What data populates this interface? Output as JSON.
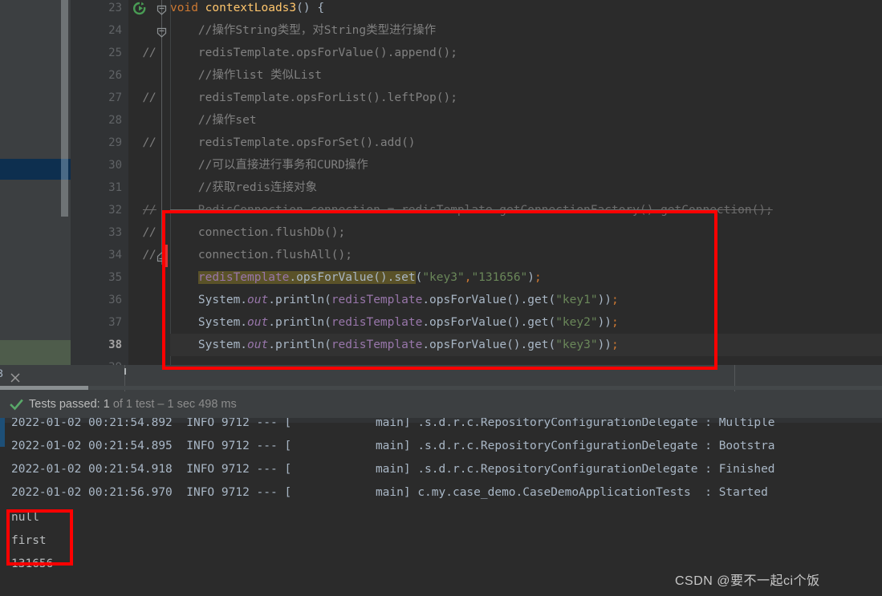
{
  "editor": {
    "lines": [
      {
        "num": "23",
        "gutter_icon": "run-method-icon",
        "fold": "fold-start",
        "comment_marker": "",
        "current": false,
        "tokens": [
          {
            "t": "void ",
            "c": "kw"
          },
          {
            "t": "contextLoads3",
            "c": "mth"
          },
          {
            "t": "() {",
            "c": "plain"
          }
        ]
      },
      {
        "num": "24",
        "gutter_icon": "",
        "fold": "fold-start",
        "comment_marker": "",
        "current": false,
        "tokens": [
          {
            "t": "    //操作String类型，对String类型进行操作",
            "c": "cmt"
          }
        ]
      },
      {
        "num": "25",
        "gutter_icon": "",
        "fold": "",
        "comment_marker": "//",
        "current": false,
        "tokens": [
          {
            "t": "    redisTemplate.opsForValue().append();",
            "c": "cmt"
          }
        ]
      },
      {
        "num": "26",
        "gutter_icon": "",
        "fold": "",
        "comment_marker": "",
        "current": false,
        "tokens": [
          {
            "t": "    //操作list 类似List",
            "c": "cmt"
          }
        ]
      },
      {
        "num": "27",
        "gutter_icon": "",
        "fold": "",
        "comment_marker": "//",
        "current": false,
        "tokens": [
          {
            "t": "    redisTemplate.opsForList().leftPop();",
            "c": "cmt"
          }
        ]
      },
      {
        "num": "28",
        "gutter_icon": "",
        "fold": "",
        "comment_marker": "",
        "current": false,
        "tokens": [
          {
            "t": "    //操作set",
            "c": "cmt"
          }
        ]
      },
      {
        "num": "29",
        "gutter_icon": "",
        "fold": "",
        "comment_marker": "//",
        "current": false,
        "tokens": [
          {
            "t": "    redisTemplate.opsForSet().add()",
            "c": "cmt"
          }
        ]
      },
      {
        "num": "30",
        "gutter_icon": "",
        "fold": "",
        "comment_marker": "",
        "current": false,
        "tokens": [
          {
            "t": "    //可以直接进行事务和CURD操作",
            "c": "cmt"
          }
        ]
      },
      {
        "num": "31",
        "gutter_icon": "",
        "fold": "",
        "comment_marker": "",
        "current": false,
        "tokens": [
          {
            "t": "    //获取redis连接对象",
            "c": "cmt"
          }
        ]
      },
      {
        "num": "32",
        "gutter_icon": "",
        "fold": "",
        "comment_marker": "//",
        "comment_marker_style": "strike",
        "current": false,
        "tokens": [
          {
            "t": "    RedisConnection connection = redisTemplate.getConnectionFactory().getConnection();",
            "c": "strike"
          }
        ]
      },
      {
        "num": "33",
        "gutter_icon": "",
        "fold": "",
        "comment_marker": "//",
        "current": false,
        "tokens": [
          {
            "t": "    connection.flushDb();",
            "c": "cmt"
          }
        ]
      },
      {
        "num": "34",
        "gutter_icon": "",
        "fold": "fold-end",
        "comment_marker": "//",
        "current": false,
        "tokens": [
          {
            "t": "    connection.flushAll();",
            "c": "cmt"
          }
        ]
      },
      {
        "num": "35",
        "gutter_icon": "",
        "fold": "",
        "comment_marker": "",
        "current": false,
        "tokens": [
          {
            "t": "    ",
            "c": "plain"
          },
          {
            "t": "redisTemplate",
            "c": "fld setbg"
          },
          {
            "t": ".",
            "c": "plain setbg"
          },
          {
            "t": "opsForValue",
            "c": "plain setbg"
          },
          {
            "t": "()",
            "c": "plain setbg"
          },
          {
            "t": ".",
            "c": "plain setbg"
          },
          {
            "t": "set",
            "c": "plain setbg"
          },
          {
            "t": "(",
            "c": "plain"
          },
          {
            "t": "\"key3\"",
            "c": "str"
          },
          {
            "t": ",",
            "c": "kw"
          },
          {
            "t": "\"131656\"",
            "c": "str"
          },
          {
            "t": ")",
            "c": "plain"
          },
          {
            "t": ";",
            "c": "kw"
          }
        ]
      },
      {
        "num": "36",
        "gutter_icon": "",
        "fold": "",
        "comment_marker": "",
        "current": false,
        "tokens": [
          {
            "t": "    System.",
            "c": "plain"
          },
          {
            "t": "out",
            "c": "ital"
          },
          {
            "t": ".println(",
            "c": "plain"
          },
          {
            "t": "redisTemplate",
            "c": "fld"
          },
          {
            "t": ".opsForValue().get(",
            "c": "plain"
          },
          {
            "t": "\"key1\"",
            "c": "str"
          },
          {
            "t": "))",
            "c": "plain"
          },
          {
            "t": ";",
            "c": "kw"
          }
        ]
      },
      {
        "num": "37",
        "gutter_icon": "",
        "fold": "",
        "comment_marker": "",
        "current": false,
        "tokens": [
          {
            "t": "    System.",
            "c": "plain"
          },
          {
            "t": "out",
            "c": "ital"
          },
          {
            "t": ".println(",
            "c": "plain"
          },
          {
            "t": "redisTemplate",
            "c": "fld"
          },
          {
            "t": ".opsForValue().get(",
            "c": "plain"
          },
          {
            "t": "\"key2\"",
            "c": "str"
          },
          {
            "t": "))",
            "c": "plain"
          },
          {
            "t": ";",
            "c": "kw"
          }
        ]
      },
      {
        "num": "38",
        "gutter_icon": "",
        "fold": "",
        "comment_marker": "",
        "current": true,
        "tokens": [
          {
            "t": "    System.",
            "c": "plain"
          },
          {
            "t": "out",
            "c": "ital"
          },
          {
            "t": ".println(",
            "c": "plain"
          },
          {
            "t": "redisTemplate",
            "c": "fld"
          },
          {
            "t": ".opsForValue().get(",
            "c": "plain"
          },
          {
            "t": "\"key3\"",
            "c": "str"
          },
          {
            "t": "))",
            "c": "plain"
          },
          {
            "t": ";",
            "c": "kw"
          }
        ]
      },
      {
        "num": "39",
        "gutter_icon": "",
        "fold": "",
        "comment_marker": "",
        "current": false,
        "tokens": []
      }
    ]
  },
  "tabstrip": {
    "close_label": "×",
    "partial_tab_text": "3"
  },
  "test_status": {
    "icon": "green-check-icon",
    "label": "Tests passed:",
    "count": "1",
    "detail": "of 1 test – 1 sec 498 ms"
  },
  "console": {
    "log_lines": [
      {
        "ts": "2022-01-02 00:21:54.892",
        "level": "INFO",
        "pid": "9712",
        "dashes": "---",
        "thread": "main]",
        "logger": ".s.d.r.c.RepositoryConfigurationDelegate",
        "msg": ": Multiple"
      },
      {
        "ts": "2022-01-02 00:21:54.895",
        "level": "INFO",
        "pid": "9712",
        "dashes": "---",
        "thread": "main]",
        "logger": ".s.d.r.c.RepositoryConfigurationDelegate",
        "msg": ": Bootstra"
      },
      {
        "ts": "2022-01-02 00:21:54.918",
        "level": "INFO",
        "pid": "9712",
        "dashes": "---",
        "thread": "main]",
        "logger": ".s.d.r.c.RepositoryConfigurationDelegate",
        "msg": ": Finished"
      },
      {
        "ts": "2022-01-02 00:21:56.970",
        "level": "INFO",
        "pid": "9712",
        "dashes": "---",
        "thread": "main]",
        "logger": "c.my.case_demo.CaseDemoApplicationTests",
        "msg": " : Started"
      }
    ],
    "program_output": [
      "null",
      "first",
      "131656"
    ]
  },
  "annotations": {
    "box_color": "#ff0000"
  },
  "watermark": {
    "text": "CSDN @要不一起ci个饭"
  }
}
